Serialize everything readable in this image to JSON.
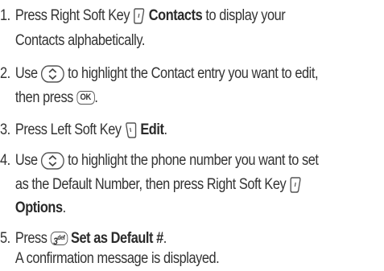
{
  "steps": [
    {
      "number": "1.",
      "line1_pre": "Press Right Soft Key",
      "line1_bold": "Contacts",
      "line1_post": "to display your",
      "line2": "Contacts alphabetically.",
      "icon": "right-soft-key-icon"
    },
    {
      "number": "2.",
      "line1_pre": "Use",
      "line1_post": "to highlight the Contact entry you want to edit,",
      "line2_pre": "then press",
      "ok_label": "OK",
      "line2_post": ".",
      "icon": "navigation-key-icon"
    },
    {
      "number": "3.",
      "line1_pre": "Press Left Soft Key",
      "line1_bold": "Edit",
      "line1_post": ".",
      "icon": "left-soft-key-icon"
    },
    {
      "number": "4.",
      "line1_pre": "Use",
      "line1_post": "to highlight the phone number you want to set",
      "line2": "as the Default Number, then press Right Soft Key",
      "line3_bold": "Options",
      "line3_post": "."
    },
    {
      "number": "5.",
      "line1_pre": "Press",
      "key_label": "3",
      "key_sub": "def",
      "line1_bold": "Set as Default #",
      "line1_post": ".",
      "line2": "A confirmation message is displayed."
    }
  ]
}
